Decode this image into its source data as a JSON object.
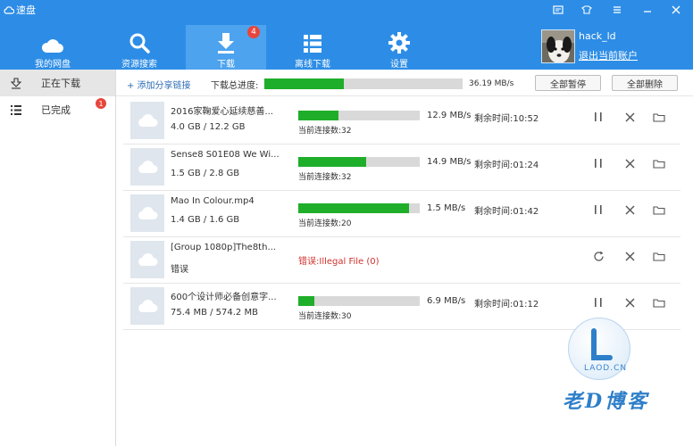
{
  "app": {
    "title": "速盘"
  },
  "nav": {
    "items": [
      {
        "label": "我的网盘"
      },
      {
        "label": "资源搜索"
      },
      {
        "label": "下载",
        "badge": "4"
      },
      {
        "label": "离线下载"
      },
      {
        "label": "设置"
      }
    ]
  },
  "user": {
    "name": "hack_ld",
    "logout": "退出当前账户"
  },
  "sidebar": {
    "items": [
      {
        "label": "正在下载"
      },
      {
        "label": "已完成",
        "badge": "1"
      }
    ]
  },
  "toolbar": {
    "add_share": "+ 添加分享链接",
    "total_label": "下载总进度:",
    "total_progress": 0.4,
    "total_speed": "36.19 MB/s",
    "pause_all": "全部暂停",
    "delete_all": "全部删除"
  },
  "downloads": [
    {
      "name": "2016家鞠爱心延续慈善...",
      "size": "4.0 GB / 12.2 GB",
      "progress": 0.33,
      "speed": "12.9 MB/s",
      "remain": "剩余时间:10:52",
      "conns": "当前连接数:32"
    },
    {
      "name": "Sense8 S01E08 We Wi...",
      "size": "1.5 GB / 2.8 GB",
      "progress": 0.56,
      "speed": "14.9 MB/s",
      "remain": "剩余时间:01:24",
      "conns": "当前连接数:32"
    },
    {
      "name": "Mao In Colour.mp4",
      "size": "1.4 GB / 1.6 GB",
      "progress": 0.91,
      "speed": "1.5 MB/s",
      "remain": "剩余时间:01:42",
      "conns": "当前连接数:20"
    },
    {
      "name": "[Group 1080p]The8th...",
      "size": "错误",
      "error": "错误:Illegal File (0)"
    },
    {
      "name": "600个设计师必备创意字...",
      "size": "75.4 MB / 574.2 MB",
      "progress": 0.13,
      "speed": "6.9 MB/s",
      "remain": "剩余时间:01:12",
      "conns": "当前连接数:30"
    }
  ],
  "watermark": {
    "site": "LAOD.CN",
    "text": "老D博客"
  },
  "colors": {
    "header": "#2d8de6",
    "progress": "#1fae2a",
    "error": "#d0312d"
  }
}
